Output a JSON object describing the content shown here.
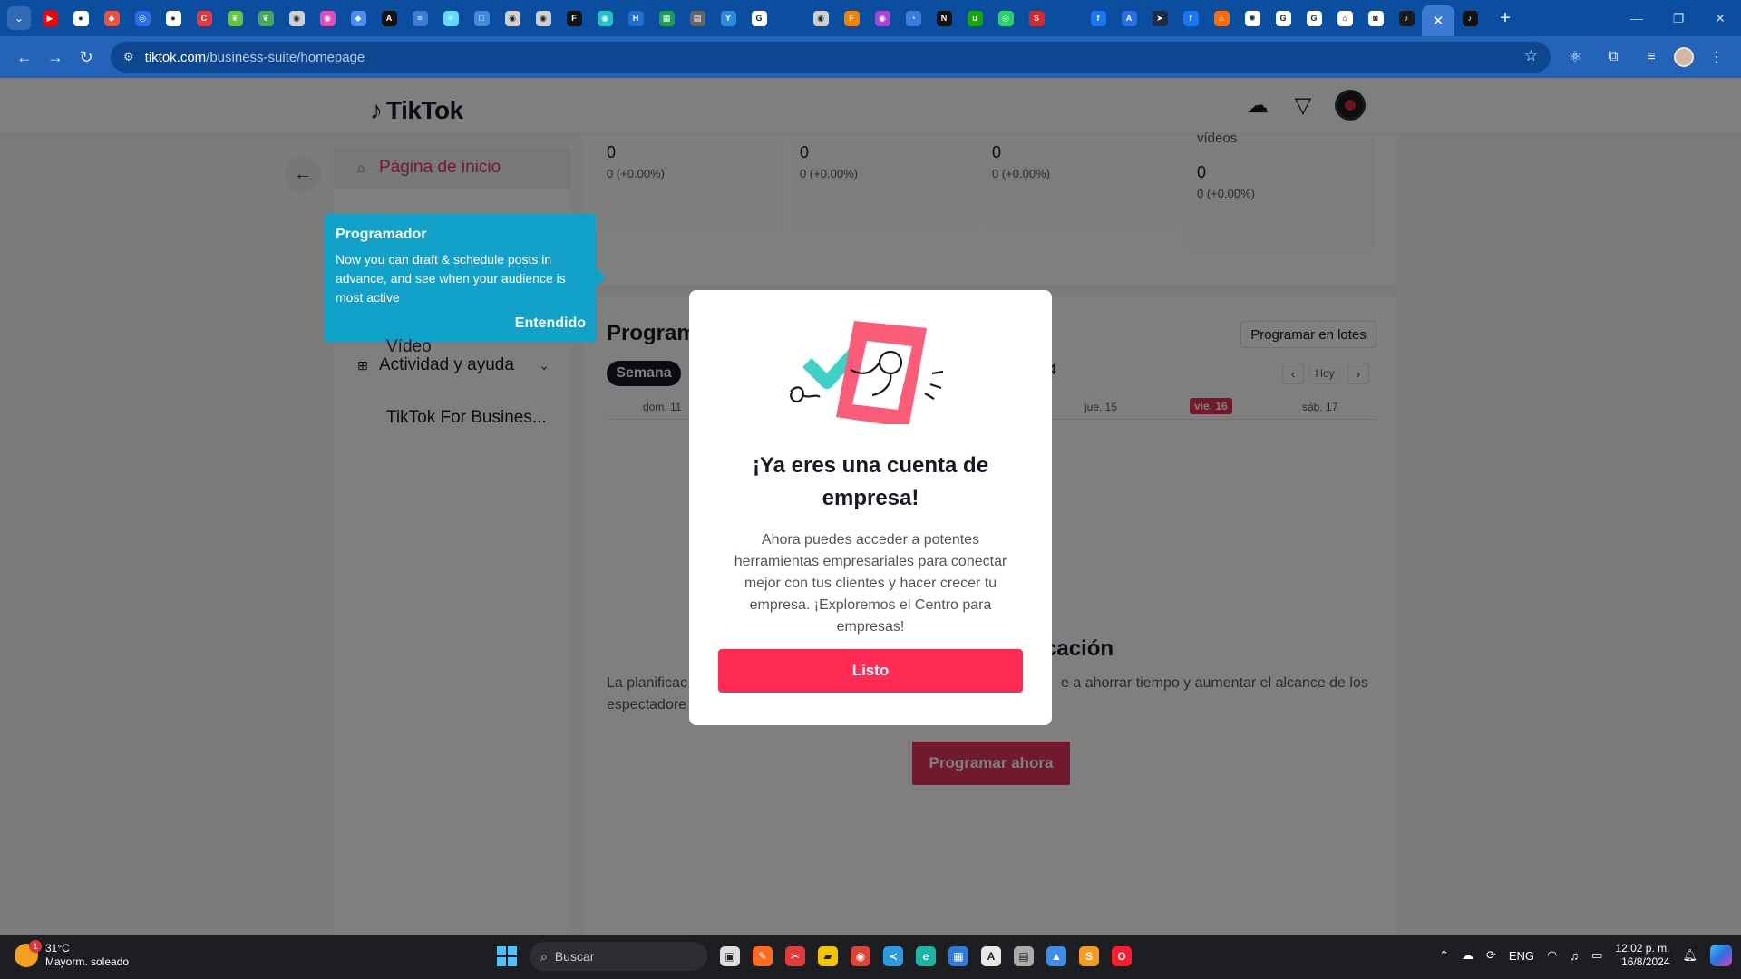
{
  "browser": {
    "tab_favicons": [
      {
        "name": "youtube-tab-icon",
        "color": "#ff0000",
        "glyph": "▶"
      },
      {
        "name": "github-tab-icon",
        "color": "#ffffff",
        "glyph": "●"
      },
      {
        "name": "git-tab-icon",
        "color": "#f05133",
        "glyph": "◆"
      },
      {
        "name": "circle-tab-icon",
        "color": "#2b6de8",
        "glyph": "◎"
      },
      {
        "name": "github-tab-icon",
        "color": "#ffffff",
        "glyph": "●"
      },
      {
        "name": "chrome-red-tab-icon",
        "color": "#e63946",
        "glyph": "C"
      },
      {
        "name": "leaf-tab-icon",
        "color": "#69c23b",
        "glyph": "❦"
      },
      {
        "name": "leaf-tab-icon",
        "color": "#48a85a",
        "glyph": "❦"
      },
      {
        "name": "globe-tab-icon",
        "color": "#d0d0d0",
        "glyph": "◉"
      },
      {
        "name": "pink-tab-icon",
        "color": "#e64bb3",
        "glyph": "◉"
      },
      {
        "name": "diamond-tab-icon",
        "color": "#4b8cf0",
        "glyph": "◆"
      },
      {
        "name": "a-tab-icon",
        "color": "#111111",
        "glyph": "A"
      },
      {
        "name": "wave-tab-icon",
        "color": "#3d7bd9",
        "glyph": "≈"
      },
      {
        "name": "react-tab-icon",
        "color": "#61dafb",
        "glyph": "⚛"
      },
      {
        "name": "box-tab-icon",
        "color": "#3f8bd6",
        "glyph": "□"
      },
      {
        "name": "globe-tab-icon",
        "color": "#d0d0d0",
        "glyph": "◉"
      },
      {
        "name": "globe-tab-icon",
        "color": "#d0d0d0",
        "glyph": "◉"
      },
      {
        "name": "f-tab-icon",
        "color": "#111111",
        "glyph": "F"
      },
      {
        "name": "teal-tab-icon",
        "color": "#21c1c7",
        "glyph": "◉"
      },
      {
        "name": "h-tab-icon",
        "color": "#1f6fd1",
        "glyph": "H"
      },
      {
        "name": "sheet-tab-icon",
        "color": "#1f9d55",
        "glyph": "▦"
      },
      {
        "name": "card-tab-icon",
        "color": "#666666",
        "glyph": "▤"
      },
      {
        "name": "y-tab-icon",
        "color": "#2a8ce0",
        "glyph": "Y"
      },
      {
        "name": "google-tab-icon",
        "color": "#ffffff",
        "glyph": "G"
      },
      {
        "name": "blank-tab-icon",
        "color": "#0b4d9e",
        "glyph": ""
      },
      {
        "name": "globe-tab-icon",
        "color": "#d0d0d0",
        "glyph": "◉"
      },
      {
        "name": "orange-f-tab-icon",
        "color": "#f77f00",
        "glyph": "F"
      },
      {
        "name": "purple-tab-icon",
        "color": "#a745d8",
        "glyph": "◉"
      },
      {
        "name": "shield-tab-icon",
        "color": "#3a7be0",
        "glyph": "◔"
      },
      {
        "name": "notion-tab-icon",
        "color": "#111111",
        "glyph": "N"
      },
      {
        "name": "upwork-tab-icon",
        "color": "#14a800",
        "glyph": "u"
      },
      {
        "name": "whatsapp-tab-icon",
        "color": "#25d366",
        "glyph": "◎"
      },
      {
        "name": "sk-tab-icon",
        "color": "#d62828",
        "glyph": "S"
      },
      {
        "name": "blank-tab-icon",
        "color": "#0b4d9e",
        "glyph": ""
      },
      {
        "name": "facebook-tab-icon",
        "color": "#1877f2",
        "glyph": "f"
      },
      {
        "name": "api-tab-icon",
        "color": "#2b6de8",
        "glyph": "A"
      },
      {
        "name": "arrow-tab-icon",
        "color": "#1f2a44",
        "glyph": "➤"
      },
      {
        "name": "facebook-tab-icon",
        "color": "#1877f2",
        "glyph": "f"
      },
      {
        "name": "fire-tab-icon",
        "color": "#ff6b00",
        "glyph": "♨"
      },
      {
        "name": "openai-tab-icon",
        "color": "#ffffff",
        "glyph": "✺"
      },
      {
        "name": "google-tab-icon",
        "color": "#ffffff",
        "glyph": "G"
      },
      {
        "name": "google-tab-icon",
        "color": "#ffffff",
        "glyph": "G"
      },
      {
        "name": "home-tab-icon",
        "color": "#ffffff",
        "glyph": "⌂"
      },
      {
        "name": "instagram-tab-icon",
        "color": "#ffffff",
        "glyph": "◙"
      },
      {
        "name": "tiktok-tab-icon",
        "color": "#1a1a1a",
        "glyph": "♪"
      }
    ],
    "active_tab_close": "✕",
    "active_tab_icon": "♪",
    "new_tab": "+",
    "url_host": "tiktok.com",
    "url_path": "/business-suite/homepage",
    "window_controls": [
      "—",
      "❐",
      "✕"
    ]
  },
  "header": {
    "logo_text": "TikTok",
    "icons": [
      "upload-cloud-icon",
      "filter-icon",
      "avatar"
    ]
  },
  "sidebar": {
    "home_label": "Página de inicio",
    "video_label": "Vídeo",
    "activity_label": "Actividad y ayuda",
    "business_label": "TikTok For Busines..."
  },
  "stats": [
    {
      "value": "0",
      "change": "0  (+0.00%)",
      "label": ""
    },
    {
      "value": "0",
      "change": "0  (+0.00%)",
      "label": ""
    },
    {
      "value": "0",
      "change": "0  (+0.00%)",
      "label": ""
    },
    {
      "value": "0",
      "change": "0  (+0.00%)",
      "label": "vídeos"
    }
  ],
  "scheduler": {
    "title": "Programador",
    "batch_button": "Programar en lotes",
    "week_tab": "Semana",
    "partial_digit": "4",
    "today_button": "Hoy",
    "days": [
      "dom. 11",
      "jue. 15",
      "vie. 16",
      "sáb. 17"
    ],
    "plan_title_fragment": "cación",
    "plan_desc_left": "La planificac\nespectadore",
    "plan_desc_right": "e a ahorrar tiempo y aumentar el alcance de los",
    "plan_button": "Programar ahora"
  },
  "tooltip": {
    "title": "Programador",
    "body": "Now you can draft & schedule posts in advance, and see when your audience is most active",
    "button": "Entendido"
  },
  "modal": {
    "title": "¡Ya eres una cuenta de empresa!",
    "body": "Ahora puedes acceder a potentes herramientas empresariales para conectar mejor con tus clientes y hacer crecer tu empresa. ¡Exploremos el Centro para empresas!",
    "button": "Listo"
  },
  "taskbar": {
    "weather_badge": "1",
    "temperature": "31°C",
    "weather_desc": "Mayorm. soleado",
    "search_placeholder": "Buscar",
    "apps": [
      {
        "name": "task-view-app-icon",
        "color": "#dddddd",
        "glyph": "▣"
      },
      {
        "name": "paint-app-icon",
        "color": "#ff6a1f",
        "glyph": "✎"
      },
      {
        "name": "snip-app-icon",
        "color": "#e03c3c",
        "glyph": "✂"
      },
      {
        "name": "explorer-app-icon",
        "color": "#f5c400",
        "glyph": "▰"
      },
      {
        "name": "chrome-app-icon",
        "color": "#db4437",
        "glyph": "◉"
      },
      {
        "name": "vscode-app-icon",
        "color": "#2b9be0",
        "glyph": "≺"
      },
      {
        "name": "edge-app-icon",
        "color": "#1bb5a3",
        "glyph": "e"
      },
      {
        "name": "calculator-app-icon",
        "color": "#2f7bd6",
        "glyph": "▦"
      },
      {
        "name": "store-app-icon",
        "color": "#e8e8e8",
        "glyph": "A"
      },
      {
        "name": "terminal-app-icon",
        "color": "#aaaaaa",
        "glyph": "▤"
      },
      {
        "name": "photos-app-icon",
        "color": "#3d8ee8",
        "glyph": "▲"
      },
      {
        "name": "sublime-app-icon",
        "color": "#f49b22",
        "glyph": "S"
      },
      {
        "name": "opera-app-icon",
        "color": "#ff1b2d",
        "glyph": "O"
      }
    ],
    "language": "ENG",
    "time": "12:02 p. m.",
    "date": "16/8/2024"
  }
}
